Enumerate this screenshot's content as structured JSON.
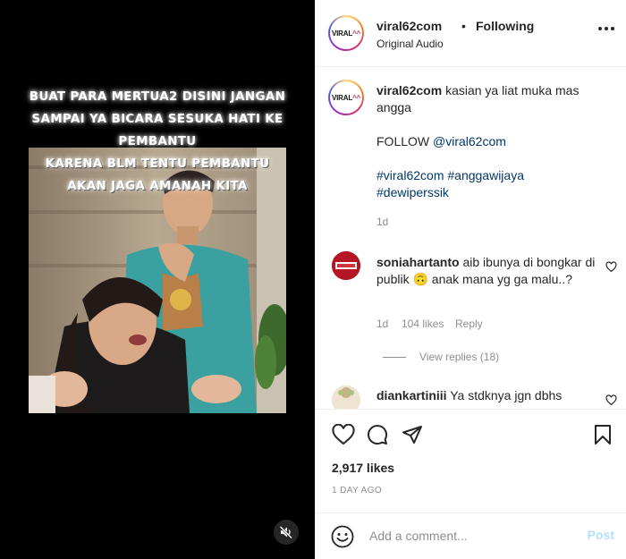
{
  "media": {
    "overlay_lines": [
      "BUAT PARA MERTUA2 DISINI JANGAN",
      "SAMPAI YA BICARA SESUKA HATI KE",
      "PEMBANTU",
      "KARENA BLM TENTU PEMBANTU",
      "AKAN JAGA AMANAH KITA"
    ],
    "mute_icon": "speaker-muted-icon"
  },
  "header": {
    "username": "viral62com",
    "separator": "•",
    "follow_status": "Following",
    "audio": "Original Audio",
    "avatar_logo_main": "VIRAL",
    "avatar_logo_accent": "^^"
  },
  "caption": {
    "username": "viral62com",
    "text": "kasian ya liat muka mas angga",
    "follow_prefix": "FOLLOW",
    "follow_mention": "@viral62com",
    "hashtags_line1": "#viral62com #anggawijaya",
    "hashtags_line2": "#dewiperssik",
    "time": "1d"
  },
  "comments": [
    {
      "username": "soniahartanto",
      "text": "aib ibunya di bongkar di publik 🙃 anak mana yg ga malu..?",
      "time": "1d",
      "likes": "104 likes",
      "reply_label": "Reply",
      "view_replies": "View replies (18)"
    },
    {
      "username": "diankartiniii",
      "text": "Ya stdknya jgn dbhs"
    }
  ],
  "actions": {
    "likes": "2,917 likes",
    "ago": "1 DAY AGO",
    "add_comment_placeholder": "Add a comment...",
    "post_label": "Post"
  },
  "colors": {
    "link_blue": "#00376b",
    "post_disabled": "#b2dffc",
    "muted_text": "#8e8e8e"
  }
}
